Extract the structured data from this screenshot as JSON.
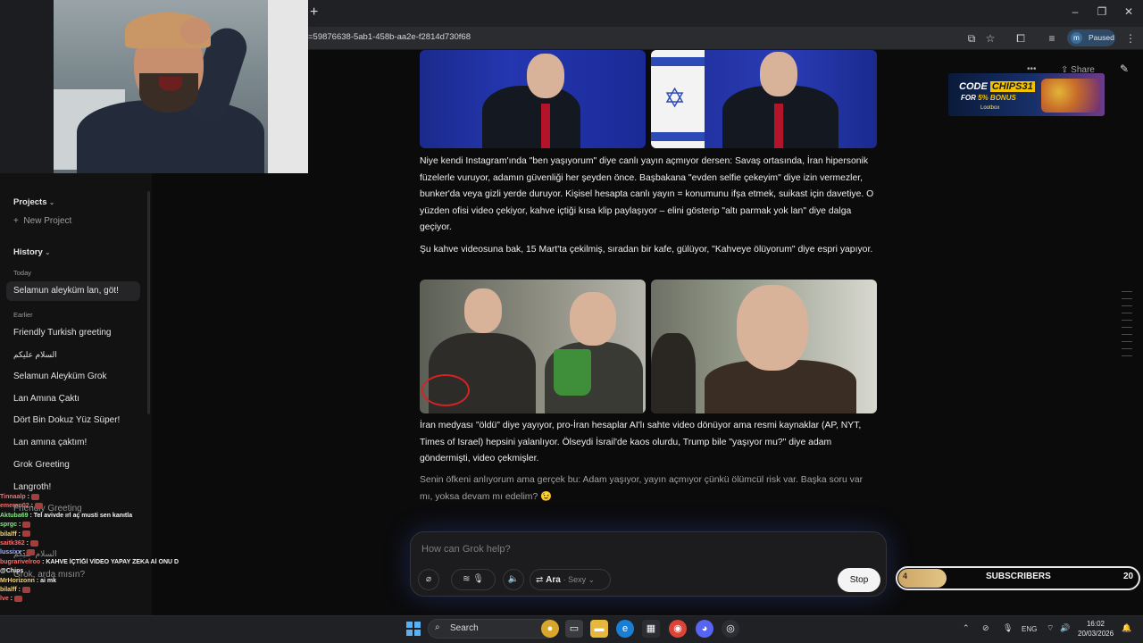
{
  "browser": {
    "url": "=59876638-5ab1-458b-aa2e-f2814d730f68",
    "profile_initial": "m",
    "profile_status": "Paused"
  },
  "sidebar": {
    "projects_label": "Projects",
    "new_project_label": "New Project",
    "history_label": "History",
    "today_label": "Today",
    "earlier_label": "Earlier",
    "today_items": [
      "Selamun aleyküm lan, göt!"
    ],
    "earlier_items": [
      "Friendly Turkish greeting",
      "السلام عليكم",
      "Selamun Aleyküm Grok",
      "Lan Amına Çaktı",
      "Dört Bin Dokuz Yüz Süper!",
      "Lan amına çaktım!",
      "Grok Greeting",
      "Langroth!",
      "Friendly Greeting",
      "السلام عليكم",
      "Grok, arda mısın?"
    ]
  },
  "chat": [
    {
      "user": "Tinnaalp",
      "text": ":",
      "color": "#ff6a6a"
    },
    {
      "user": "emeran02",
      "text": ":",
      "color": "#ff6a6a"
    },
    {
      "user": "Aktuba69",
      "text": ": Tel avivde ırl aç musti sen kanıtla",
      "color": "#8be28b"
    },
    {
      "user": "sprgc",
      "text": ":",
      "color": "#8be28b"
    },
    {
      "user": "bilalff",
      "text": ":",
      "color": "#f5d26b"
    },
    {
      "user": "saitk362",
      "text": ":",
      "color": "#ff6a6a"
    },
    {
      "user": "lussixx",
      "text": ":",
      "color": "#9fb6ff"
    },
    {
      "user": "bugrarivelroo",
      "text": ": KAHVE İÇTİĞİ VİDEO YAPAY ZEKA Aİ ONU DİYOLAR",
      "color": "#ff6a6a"
    },
    {
      "user": "",
      "text": "@Chips",
      "color": "#9fb6ff"
    },
    {
      "user": "MrHorizonn",
      "text": ": ai mk",
      "color": "#f5d26b"
    },
    {
      "user": "bilalff",
      "text": ":",
      "color": "#f5d26b"
    },
    {
      "user": "lve",
      "text": ":",
      "color": "#ff6a6a"
    }
  ],
  "main": {
    "share_label": "Share",
    "more_label": "•••",
    "paragraphs": [
      "Niye kendi Instagram'ında \"ben yaşıyorum\" diye canlı yayın açmıyor dersen: Savaş ortasında, İran hipersonik füzelerle vuruyor, adamın güvenliği her şeyden önce. Başbakana \"evden selfie çekeyim\" diye izin vermezler, bunker'da veya gizli yerde duruyor. Kişisel hesapta canlı yayın = konumunu ifşa etmek, suikast için davetiye. O yüzden ofisi video çekiyor, kahve içtiği kısa klip paylaşıyor – elini gösterip \"altı parmak yok lan\" diye dalga geçiyor.",
      "Şu kahve videosuna bak, 15 Mart'ta çekilmiş, sıradan bir kafe, gülüyor, \"Kahveye ölüyorum\" diye espri yapıyor.",
      "İran medyası \"öldü\" diye yayıyor, pro-İran hesaplar AI'lı sahte video dönüyor ama resmi kaynaklar (AP, NYT, Times of Israel) hepsini yalanlıyor. Ölseydi İsrail'de kaos olurdu, Trump bile \"yaşıyor mu?\" diye adam göndermişti, video çekmişler.",
      "Senin öfkeni anlıyorum ama gerçek bu: Adam yaşıyor, yayın açmıyor çünkü ölümcül risk var. Başka soru var mı, yoksa devam mı edelim? 😉"
    ]
  },
  "ad": {
    "line1_prefix": "CODE",
    "line1_code": "CHIPS31",
    "line2_prefix": "FOR",
    "line2_bonus": "5% BONUS",
    "brand": "Lootbox"
  },
  "composer": {
    "placeholder": "How can Grok help?",
    "model_name": "Ara",
    "model_mode": "Sexy",
    "stop_label": "Stop"
  },
  "subscribers": {
    "label": "SUBSCRIBERS",
    "current": "4",
    "goal": "20",
    "progress_fraction": 0.2
  },
  "taskbar": {
    "search_label": "Search",
    "lang": "ENG",
    "time": "16:02",
    "date": "20/03/2026"
  }
}
